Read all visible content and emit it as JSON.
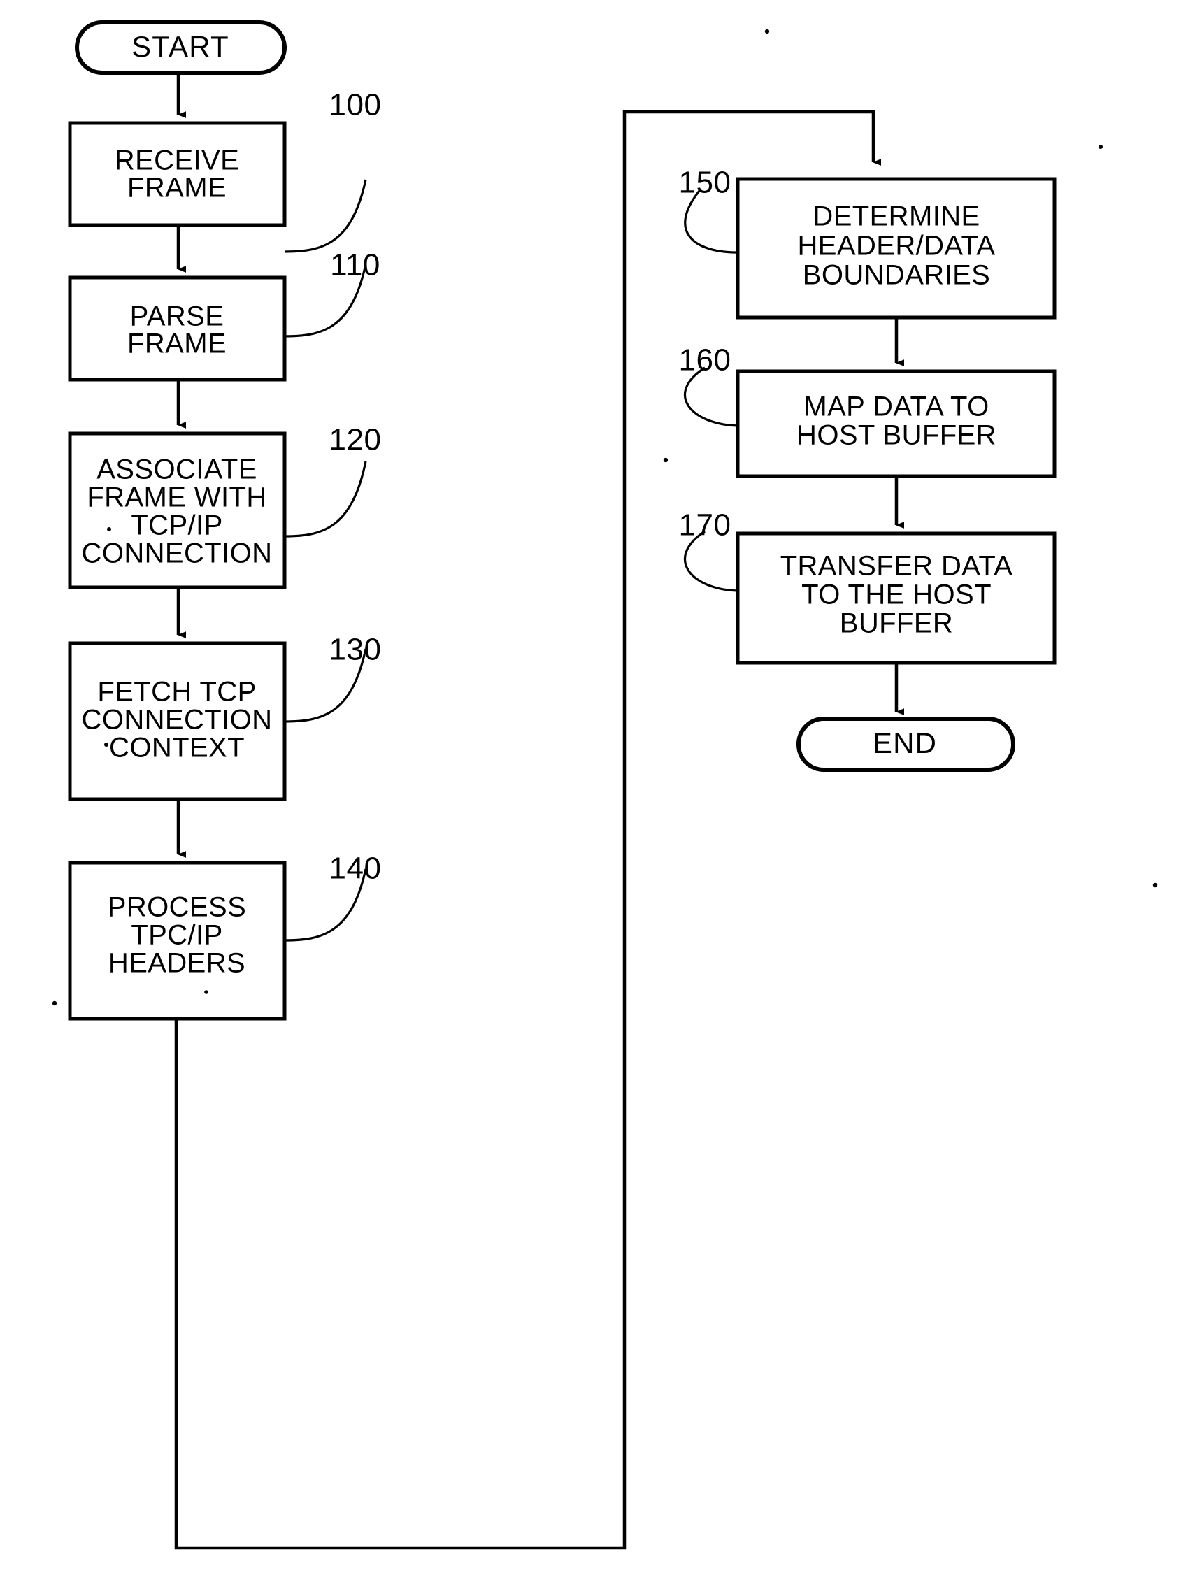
{
  "diagram": {
    "type": "flowchart",
    "title": "TCP/IP frame receive processing flowchart",
    "orientation": "two-column, top-to-bottom with feedback loop",
    "background_color": "#ffffff",
    "line_color": "#000000",
    "start_label": "START",
    "end_label": "END",
    "nodes": [
      {
        "id": "start",
        "shape": "terminator",
        "lines": [
          "START"
        ],
        "ref": null
      },
      {
        "id": "receive-frame",
        "shape": "process",
        "lines": [
          "RECEIVE",
          "FRAME"
        ],
        "ref": "100"
      },
      {
        "id": "parse-frame",
        "shape": "process",
        "lines": [
          "PARSE",
          "FRAME"
        ],
        "ref": "110"
      },
      {
        "id": "associate-frame",
        "shape": "process",
        "lines": [
          "ASSOCIATE",
          "FRAME WITH",
          "TCP/IP",
          "CONNECTION"
        ],
        "ref": "120"
      },
      {
        "id": "fetch-context",
        "shape": "process",
        "lines": [
          "FETCH TCP",
          "CONNECTION",
          "CONTEXT"
        ],
        "ref": "130"
      },
      {
        "id": "process-headers",
        "shape": "process",
        "lines": [
          "PROCESS",
          "TPC/IP",
          "HEADERS"
        ],
        "ref": "140"
      },
      {
        "id": "determine-boundaries",
        "shape": "process",
        "lines": [
          "DETERMINE",
          "HEADER/DATA",
          "BOUNDARIES"
        ],
        "ref": "150"
      },
      {
        "id": "map-data",
        "shape": "process",
        "lines": [
          "MAP DATA TO",
          "HOST BUFFER"
        ],
        "ref": "160"
      },
      {
        "id": "transfer-data",
        "shape": "process",
        "lines": [
          "TRANSFER DATA",
          "TO THE HOST",
          "BUFFER"
        ],
        "ref": "170"
      },
      {
        "id": "end",
        "shape": "terminator",
        "lines": [
          "END"
        ],
        "ref": null
      }
    ],
    "reference_numerals": [
      "100",
      "110",
      "120",
      "130",
      "140",
      "150",
      "160",
      "170"
    ],
    "edges": [
      {
        "from": "start",
        "to": "receive-frame",
        "arrow": true
      },
      {
        "from": "receive-frame",
        "to": "parse-frame",
        "arrow": true
      },
      {
        "from": "parse-frame",
        "to": "associate-frame",
        "arrow": true
      },
      {
        "from": "associate-frame",
        "to": "fetch-context",
        "arrow": true
      },
      {
        "from": "fetch-context",
        "to": "process-headers",
        "arrow": true
      },
      {
        "from": "process-headers",
        "to": "determine-boundaries",
        "arrow": true,
        "routing": "down-right-up-right-down feedback connector"
      },
      {
        "from": "determine-boundaries",
        "to": "map-data",
        "arrow": true
      },
      {
        "from": "map-data",
        "to": "transfer-data",
        "arrow": true
      },
      {
        "from": "transfer-data",
        "to": "end",
        "arrow": true
      }
    ]
  },
  "text": {
    "start": "START",
    "receive_frame_l1": "RECEIVE",
    "receive_frame_l2": "FRAME",
    "parse_frame_l1": "PARSE",
    "parse_frame_l2": "FRAME",
    "associate_l1": "ASSOCIATE",
    "associate_l2": "FRAME WITH",
    "associate_l3": "TCP/IP",
    "associate_l4": "CONNECTION",
    "fetch_l1": "FETCH TCP",
    "fetch_l2": "CONNECTION",
    "fetch_l3": "CONTEXT",
    "process_l1": "PROCESS",
    "process_l2": "TPC/IP",
    "process_l3": "HEADERS",
    "determine_l1": "DETERMINE",
    "determine_l2": "HEADER/DATA",
    "determine_l3": "BOUNDARIES",
    "map_l1": "MAP DATA TO",
    "map_l2": "HOST BUFFER",
    "transfer_l1": "TRANSFER DATA",
    "transfer_l2": "TO THE HOST",
    "transfer_l3": "BUFFER",
    "end": "END",
    "ref_100": "100",
    "ref_110": "110",
    "ref_120": "120",
    "ref_130": "130",
    "ref_140": "140",
    "ref_150": "150",
    "ref_160": "160",
    "ref_170": "170"
  }
}
